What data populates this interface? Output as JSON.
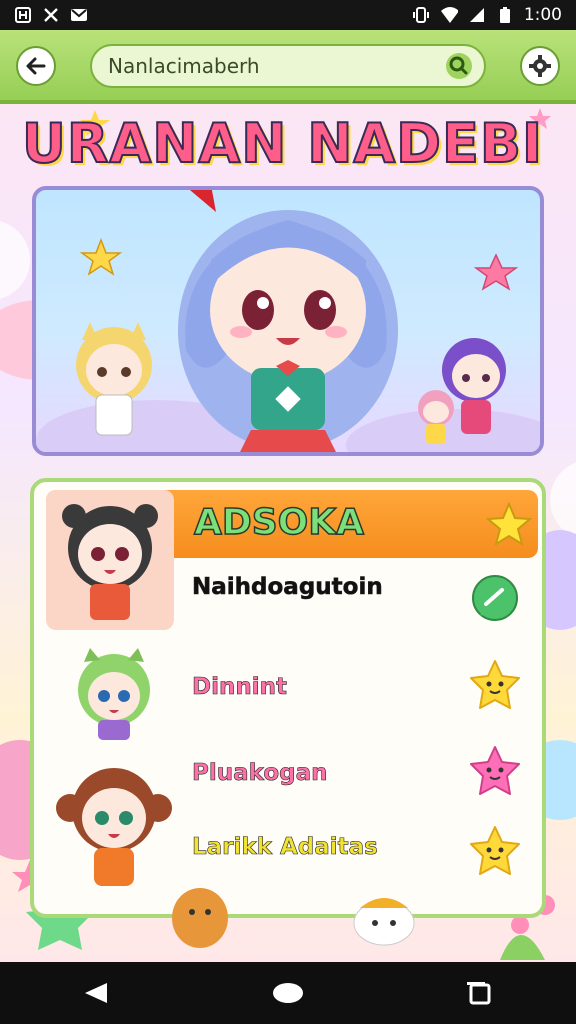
{
  "status_bar": {
    "time": "1:00",
    "left_icons": [
      "app-icon",
      "cross-icon",
      "mail-icon"
    ],
    "right_icons": [
      "vibrate-icon",
      "wifi-icon",
      "signal-icon",
      "battery-icon"
    ]
  },
  "app_bar": {
    "back_icon": "arrow-left-icon",
    "search": {
      "value": "Nanlacimaberh",
      "icon": "search-icon"
    },
    "settings_icon": "gear-icon"
  },
  "banner": {
    "title": "URANAN NADEBI"
  },
  "list": {
    "header": {
      "label": "ADSOKA",
      "icon": "star-icon"
    },
    "items": [
      {
        "label": "Naihdoagutoin",
        "icon": "chat-bubble-icon",
        "color": "#111111"
      },
      {
        "label": "Dinnint",
        "icon": "yellow-star-face-icon",
        "color": "#ff6fa8"
      },
      {
        "label": "Pluakogan",
        "icon": "pink-star-face-icon",
        "color": "#ff6fa8"
      },
      {
        "label": "Larikk Adaitas",
        "icon": "yellow-star-face-icon",
        "color": "#f2e234"
      }
    ]
  },
  "colors": {
    "accent_green": "#96cf55",
    "header_orange": "#f58d1e",
    "banner_border": "#9a8bd6"
  }
}
